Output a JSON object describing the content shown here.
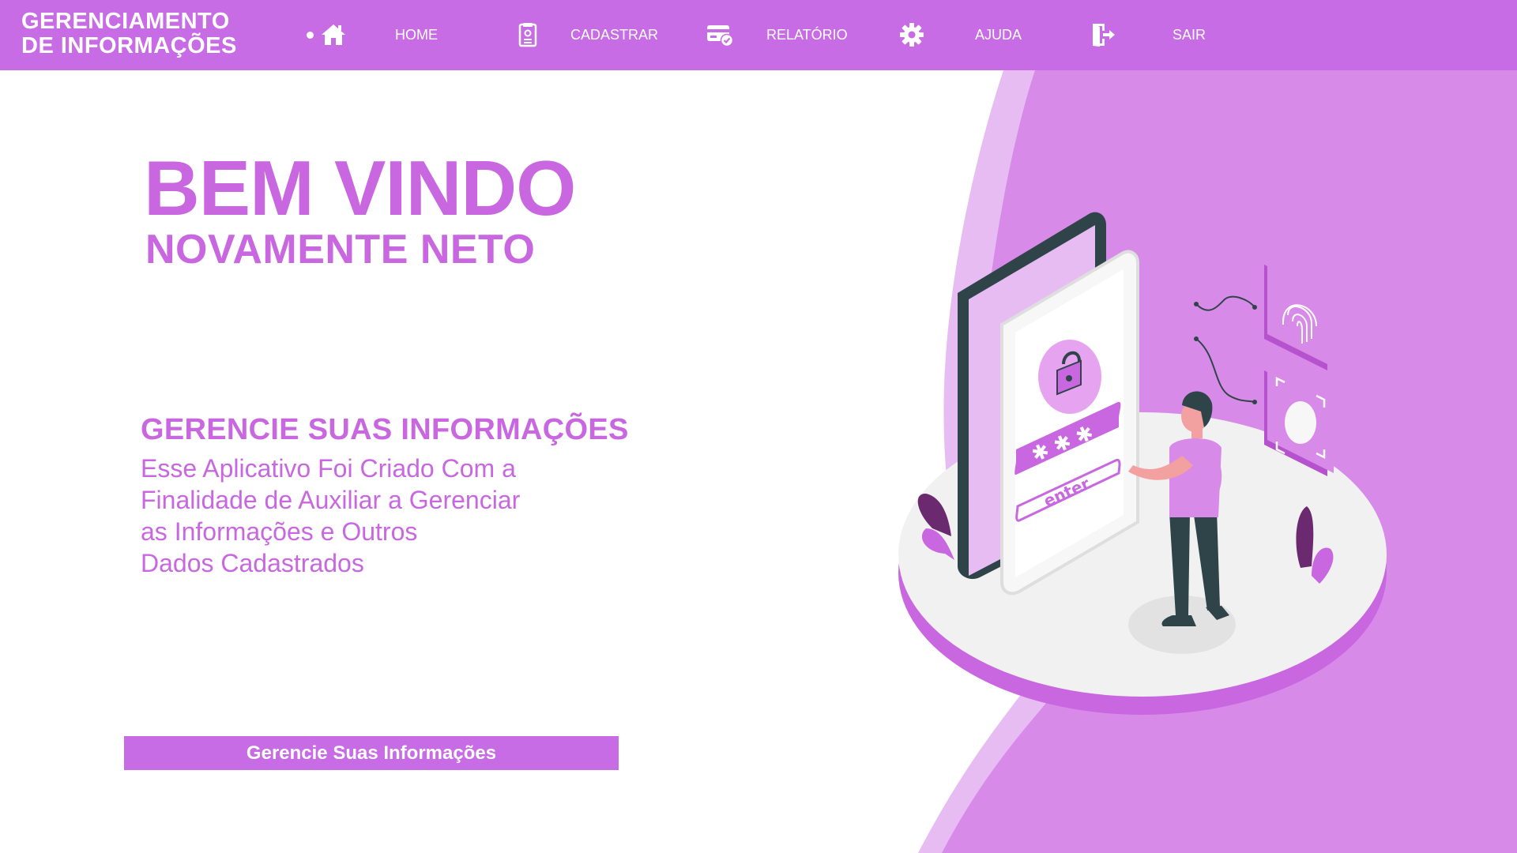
{
  "brand": {
    "line1": "GERENCIAMENTO",
    "line2": "DE INFORMAÇÕES"
  },
  "nav": {
    "home": {
      "label": "HOME",
      "icon": "home-icon"
    },
    "cadastrar": {
      "label": "CADASTRAR",
      "icon": "document-icon"
    },
    "relatorio": {
      "label": "RELATÓRIO",
      "icon": "card-check-icon"
    },
    "ajuda": {
      "label": "AJUDA",
      "icon": "gear-icon"
    },
    "sair": {
      "label": "SAIR",
      "icon": "logout-icon"
    }
  },
  "hero": {
    "title": "BEM VINDO",
    "subtitle": "NOVAMENTE NETO"
  },
  "section": {
    "heading": "GERENCIE SUAS INFORMAÇÕES",
    "description_lines": [
      "Esse Aplicativo Foi Criado Com a",
      "Finalidade de Auxiliar a Gerenciar",
      "as Informações e Outros",
      "Dados Cadastrados"
    ]
  },
  "cta": {
    "label": "Gerencie Suas Informações"
  },
  "illustration": {
    "enter_text": "enter"
  },
  "colors": {
    "accent": "#c86ce6",
    "text_accent": "#c867e0",
    "light_purple": "#e4b8f2",
    "dark": "#2f4449"
  }
}
